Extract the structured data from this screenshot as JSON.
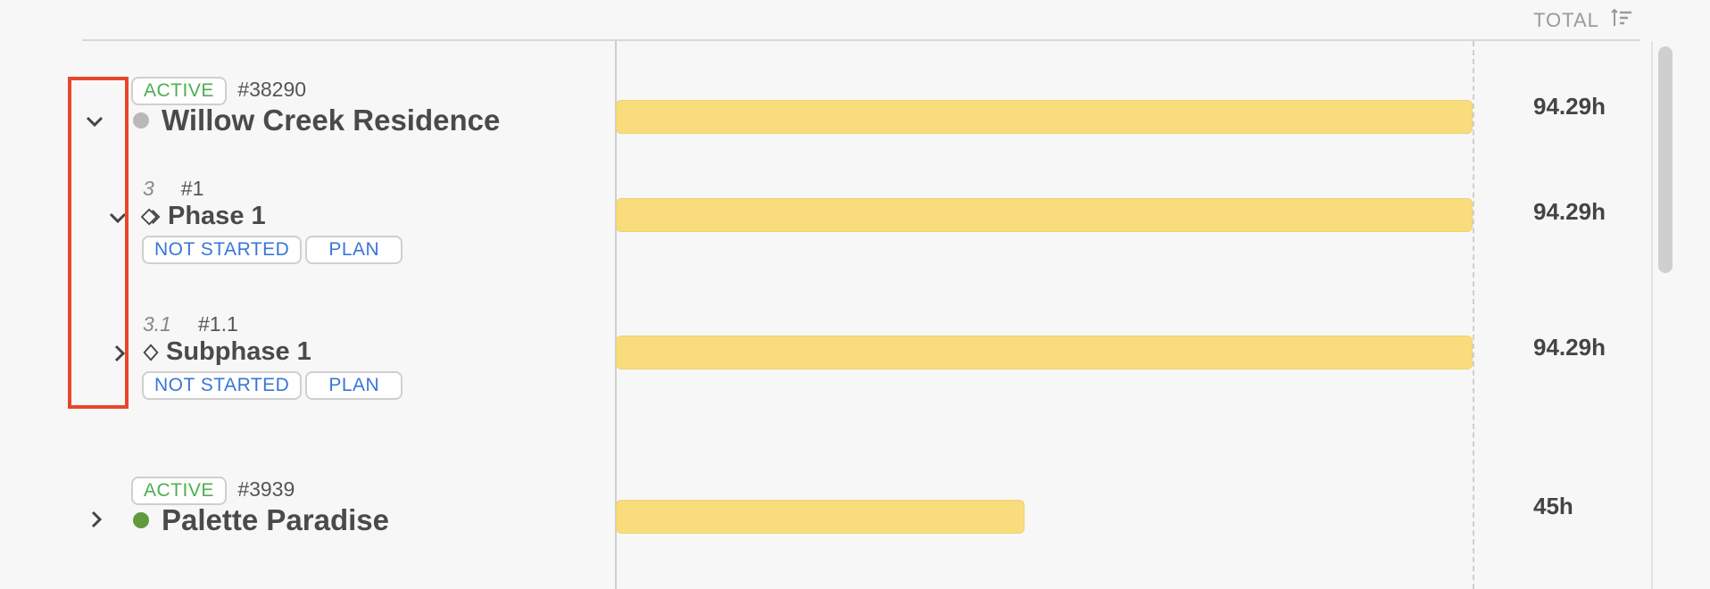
{
  "header": {
    "total_label": "TOTAL"
  },
  "rows": [
    {
      "status": "ACTIVE",
      "id": "#38290",
      "title": "Willow Creek Residence",
      "dot_color": "#b9b9b9",
      "total": "94.29h",
      "bar_fraction": 1.0
    },
    {
      "number": "3",
      "id": "#1",
      "title": "Phase 1",
      "status": "NOT STARTED",
      "tag": "PLAN",
      "total": "94.29h",
      "bar_fraction": 1.0
    },
    {
      "number": "3.1",
      "id": "#1.1",
      "title": "Subphase 1",
      "status": "NOT STARTED",
      "tag": "PLAN",
      "total": "94.29h",
      "bar_fraction": 1.0
    },
    {
      "status": "ACTIVE",
      "id": "#3939",
      "title": "Palette Paradise",
      "dot_color": "#5f9a3d",
      "total": "45h",
      "bar_fraction": 0.477
    }
  ],
  "colors": {
    "accent_green": "#4caf50",
    "accent_blue": "#3a76d8",
    "bar_fill": "#f9dd7d",
    "highlight": "#e8472a"
  }
}
